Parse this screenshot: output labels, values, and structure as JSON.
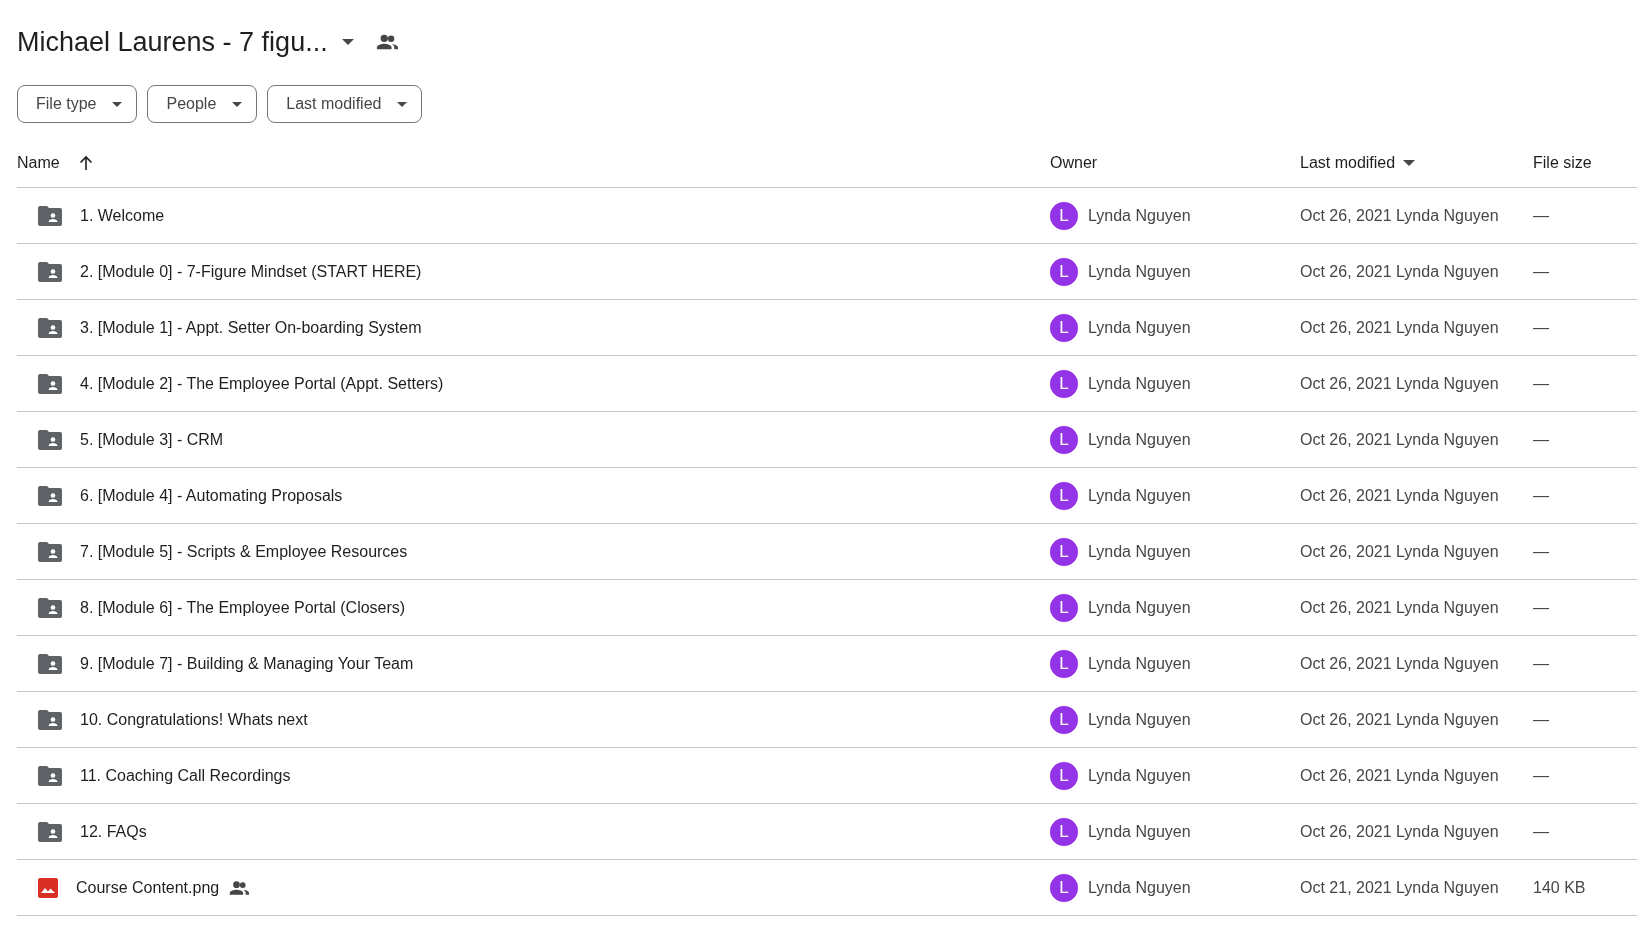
{
  "folder": {
    "title": "Michael Laurens - 7 figu...",
    "shared": true
  },
  "filters": [
    "File type",
    "People",
    "Last modified"
  ],
  "columns": [
    {
      "label": "Name",
      "sorted": true,
      "ascending": true
    },
    {
      "label": "Owner",
      "sorted": false
    },
    {
      "label": "Last modified",
      "sorted": true,
      "ascending": false
    },
    {
      "label": "File size",
      "sorted": false
    }
  ],
  "rows": [
    {
      "kind": "folder",
      "name": "1. Welcome",
      "shared": false,
      "owner_initial": "L",
      "owner": "Lynda Nguyen",
      "modified": "Oct 26, 2021 Lynda Nguyen",
      "size": "—"
    },
    {
      "kind": "folder",
      "name": "2. [Module 0] - 7-Figure Mindset (START HERE)",
      "shared": false,
      "owner_initial": "L",
      "owner": "Lynda Nguyen",
      "modified": "Oct 26, 2021 Lynda Nguyen",
      "size": "—"
    },
    {
      "kind": "folder",
      "name": "3. [Module 1] - Appt. Setter On-boarding System",
      "shared": false,
      "owner_initial": "L",
      "owner": "Lynda Nguyen",
      "modified": "Oct 26, 2021 Lynda Nguyen",
      "size": "—"
    },
    {
      "kind": "folder",
      "name": "4. [Module 2] - The Employee Portal (Appt. Setters)",
      "shared": false,
      "owner_initial": "L",
      "owner": "Lynda Nguyen",
      "modified": "Oct 26, 2021 Lynda Nguyen",
      "size": "—"
    },
    {
      "kind": "folder",
      "name": "5. [Module 3] - CRM",
      "shared": false,
      "owner_initial": "L",
      "owner": "Lynda Nguyen",
      "modified": "Oct 26, 2021 Lynda Nguyen",
      "size": "—"
    },
    {
      "kind": "folder",
      "name": "6. [Module 4] - Automating Proposals",
      "shared": false,
      "owner_initial": "L",
      "owner": "Lynda Nguyen",
      "modified": "Oct 26, 2021 Lynda Nguyen",
      "size": "—"
    },
    {
      "kind": "folder",
      "name": "7. [Module 5] - Scripts & Employee Resources",
      "shared": false,
      "owner_initial": "L",
      "owner": "Lynda Nguyen",
      "modified": "Oct 26, 2021 Lynda Nguyen",
      "size": "—"
    },
    {
      "kind": "folder",
      "name": "8. [Module 6] - The Employee Portal (Closers)",
      "shared": false,
      "owner_initial": "L",
      "owner": "Lynda Nguyen",
      "modified": "Oct 26, 2021 Lynda Nguyen",
      "size": "—"
    },
    {
      "kind": "folder",
      "name": "9. [Module 7] - Building & Managing Your Team",
      "shared": false,
      "owner_initial": "L",
      "owner": "Lynda Nguyen",
      "modified": "Oct 26, 2021 Lynda Nguyen",
      "size": "—"
    },
    {
      "kind": "folder",
      "name": "10. Congratulations! Whats next",
      "shared": false,
      "owner_initial": "L",
      "owner": "Lynda Nguyen",
      "modified": "Oct 26, 2021 Lynda Nguyen",
      "size": "—"
    },
    {
      "kind": "folder",
      "name": "11. Coaching Call Recordings",
      "shared": false,
      "owner_initial": "L",
      "owner": "Lynda Nguyen",
      "modified": "Oct 26, 2021 Lynda Nguyen",
      "size": "—"
    },
    {
      "kind": "folder",
      "name": "12. FAQs",
      "shared": false,
      "owner_initial": "L",
      "owner": "Lynda Nguyen",
      "modified": "Oct 26, 2021 Lynda Nguyen",
      "size": "—"
    },
    {
      "kind": "image",
      "name": "Course Content.png",
      "shared": true,
      "owner_initial": "L",
      "owner": "Lynda Nguyen",
      "modified": "Oct 21, 2021 Lynda Nguyen",
      "size": "140 KB"
    }
  ]
}
